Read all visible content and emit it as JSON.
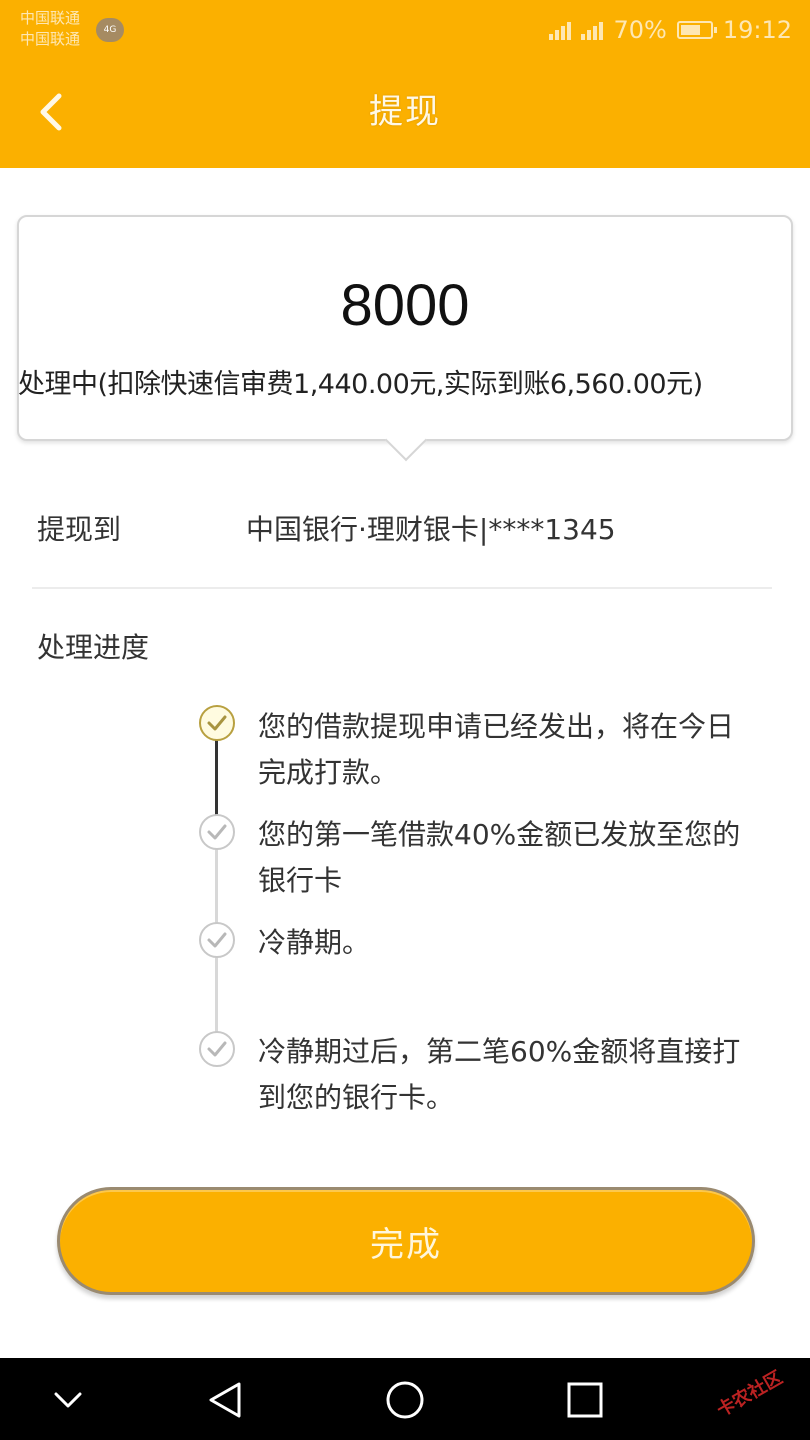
{
  "status_bar": {
    "carrier_1": "中国联通",
    "carrier_2": "中国联通",
    "carrier_badge": "4G",
    "battery": "70%",
    "time": "19:12"
  },
  "header": {
    "title": "提现",
    "background": "#fbb000"
  },
  "amount": {
    "value": "8000",
    "status": "处理中(扣除快速信审费1,440.00元,实际到账6,560.00元)"
  },
  "withdraw_to": {
    "label": "提现到",
    "value": "中国银行·理财银卡|****1345"
  },
  "progress": {
    "label": "处理进度",
    "steps": [
      {
        "text": "您的借款提现申请已经发出，将在今日完成打款。",
        "icon": "check-circle-icon"
      },
      {
        "text": "您的第一笔借款40%金额已发放至您的银行卡",
        "icon": "check-circle-icon"
      },
      {
        "text": "冷静期。",
        "icon": "check-circle-icon"
      },
      {
        "text": "冷静期过后，第二笔60%金额将直接打到您的银行卡。",
        "icon": "check-circle-icon"
      }
    ]
  },
  "done_button": {
    "label": "完成"
  },
  "nav": {
    "icons": [
      "chevron-down-icon",
      "back-triangle-icon",
      "home-circle-icon",
      "recents-square-icon"
    ]
  },
  "watermark": "卡农社区"
}
